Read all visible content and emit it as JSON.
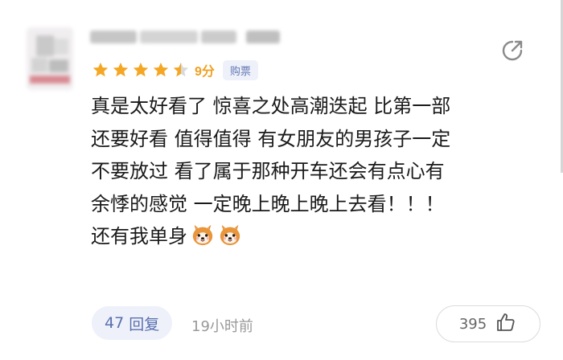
{
  "review": {
    "rating": {
      "stars_filled": 4.5,
      "stars_total": 5,
      "score_text": "9分"
    },
    "purchase_badge": "购票",
    "content_lines": [
      "真是太好看了 惊喜之处高潮迭起 比第一部",
      "还要好看 值得值得 有女朋友的男孩子一定",
      "不要放过 看了属于那种开车还会有点心有",
      "余悸的感觉 一定晚上晚上晚上去看！！！",
      "还有我单身"
    ],
    "emojis": [
      "shiba-dog-emoji",
      "shiba-dog-emoji"
    ],
    "reply_count": "47",
    "reply_label": "回复",
    "time_ago": "19小时前",
    "like_count": "395",
    "icons": {
      "share": "share-arrow-icon",
      "like": "thumbs-up-icon",
      "star": "star-icon"
    },
    "colors": {
      "star": "#f5a623",
      "score": "#f0a020",
      "badge_bg": "#eef1fa",
      "badge_text": "#6478b4",
      "text": "#1a1a1a",
      "muted": "#999999"
    }
  }
}
